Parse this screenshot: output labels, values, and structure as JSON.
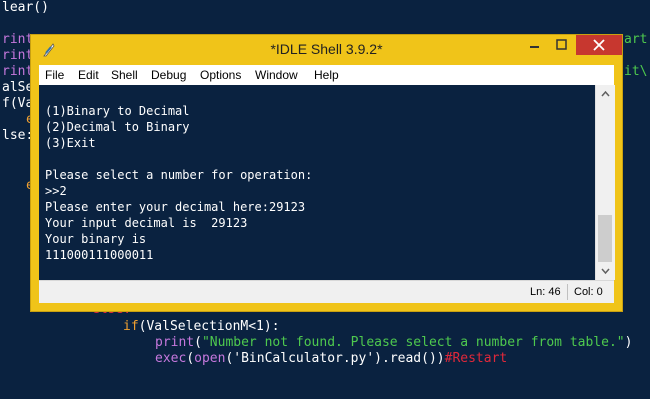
{
  "background_editor": {
    "lines": [
      {
        "text": "lear()",
        "color": "white"
      },
      {
        "text": "rint",
        "color": "purple"
      },
      {
        "text": "rint",
        "color": "purple"
      },
      {
        "text": "rint",
        "color": "purple"
      },
      {
        "text": "alSe",
        "color": "white"
      },
      {
        "text": "f(Va",
        "color": "white"
      },
      {
        "text": "e",
        "color": "orange"
      },
      {
        "text": "lse:",
        "color": "white"
      },
      {
        "text": "e",
        "color": "orange"
      },
      {
        "text": "art",
        "color": "green"
      },
      {
        "text": "it\\",
        "color": "green"
      },
      {
        "text": "else:",
        "color": "red"
      }
    ],
    "code": {
      "if_kw": "if",
      "if_rest": "(ValSelectionM<1):",
      "print_kw": "print",
      "print_str": "\"Number not found. Please select a number from table.\"",
      "print_close": ")",
      "exec_kw": "exec",
      "exec_open_paren": "(",
      "open_kw": "open",
      "open_arg": "('BinCalculator.py')",
      "read_call": ".read())",
      "comment": "#Restart"
    }
  },
  "window": {
    "title": "*IDLE Shell 3.9.2*",
    "menu": [
      "File",
      "Edit",
      "Shell",
      "Debug",
      "Options",
      "Window",
      "Help"
    ]
  },
  "shell": {
    "output": "(1)Binary to Decimal\n(2)Decimal to Binary\n(3)Exit\n\nPlease select a number for operation:\n>>2\nPlease enter your decimal here:29123\nYour input decimal is  29123\nYour binary is\n111000111000011"
  },
  "status": {
    "line": "Ln: 46",
    "col": "Col: 0"
  },
  "colors": {
    "editor_bg": "#0a2240",
    "window_frame": "#f0c419",
    "close_button": "#c7372f"
  }
}
